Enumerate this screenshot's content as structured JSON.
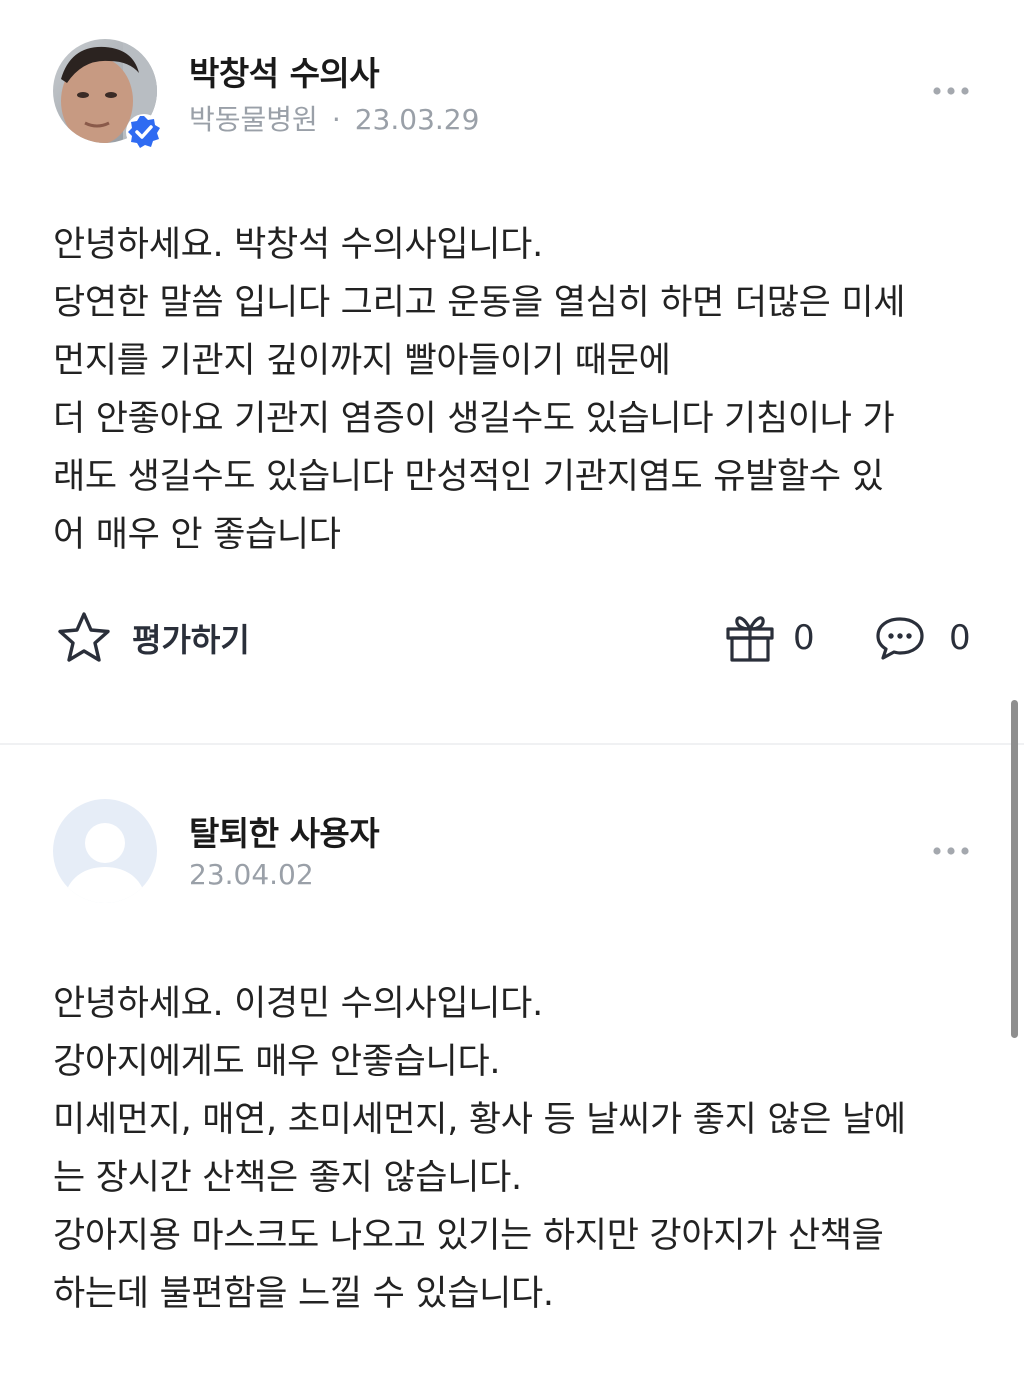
{
  "posts": [
    {
      "author": "박창석 수의사",
      "hospital": "박동물병원",
      "date": "23.03.29",
      "verified": true,
      "avatar": "profile-photo",
      "body_lines": [
        "안녕하세요. 박창석 수의사입니다.",
        "당연한 말씀 입니다 그리고 운동을 열심히 하면 더많은 미세",
        "먼지를 기관지 깊이까지  빨아들이기 때문에",
        "더 안좋아요  기관지 염증이 생길수도 있습니다  기침이나 가",
        "래도 생길수도 있습니다  만성적인 기관지염도 유발할수 있",
        "어 매우 안 좋습니다"
      ],
      "actions": {
        "rate_label": "평가하기",
        "gift_count": "0",
        "comment_count": "0"
      }
    },
    {
      "author": "탈퇴한 사용자",
      "date": "23.04.02",
      "verified": false,
      "avatar": "default-user-avatar",
      "body_lines": [
        "안녕하세요. 이경민 수의사입니다.",
        "강아지에게도 매우 안좋습니다.",
        "미세먼지, 매연, 초미세먼지, 황사 등 날씨가 좋지 않은 날에",
        "는 장시간 산책은 좋지 않습니다.",
        "강아지용 마스크도 나오고 있기는 하지만 강아지가 산책을",
        "하는데 불편함을 느낄 수 있습니다."
      ]
    }
  ],
  "meta_separator": "·",
  "icons": {
    "more": "more-horizontal-icon",
    "verified": "verified-badge-icon",
    "rate": "star-outline-icon",
    "gift": "gift-icon",
    "comment": "chat-bubble-icon"
  },
  "colors": {
    "verified_blue": "#2f6bf2",
    "meta_gray": "#9aa0a8",
    "default_avatar_bg": "#e6edf7"
  }
}
